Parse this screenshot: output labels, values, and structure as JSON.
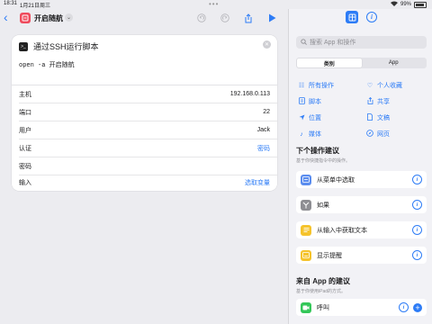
{
  "status": {
    "time": "18:31",
    "date": "1月21日周三",
    "battery": "99%"
  },
  "toolbar": {
    "shortcut_name": "开启随航"
  },
  "action": {
    "title": "通过SSH运行脚本",
    "script": "open -a 开启随航",
    "fields": [
      {
        "label": "主机",
        "value": "192.168.0.113",
        "link": false
      },
      {
        "label": "端口",
        "value": "22",
        "link": false
      },
      {
        "label": "用户",
        "value": "Jack",
        "link": false
      },
      {
        "label": "认证",
        "value": "密码",
        "link": true
      },
      {
        "label": "密码",
        "value": "",
        "link": false
      },
      {
        "label": "输入",
        "value": "选取变量",
        "link": true
      }
    ]
  },
  "sidebar": {
    "search_placeholder": "搜索 App 和操作",
    "segments": [
      "类别",
      "App"
    ],
    "active_segment": 0,
    "categories": [
      {
        "label": "所有操作",
        "icon": "grid-icon"
      },
      {
        "label": "个人收藏",
        "icon": "heart-icon"
      },
      {
        "label": "脚本",
        "icon": "script-icon"
      },
      {
        "label": "共享",
        "icon": "share-icon"
      },
      {
        "label": "位置",
        "icon": "location-icon"
      },
      {
        "label": "文稿",
        "icon": "document-icon"
      },
      {
        "label": "媒体",
        "icon": "music-icon"
      },
      {
        "label": "网页",
        "icon": "compass-icon"
      }
    ],
    "next_title": "下个操作建议",
    "next_sub": "基于你快捷指令中的操作。",
    "suggestions": [
      {
        "label": "从菜单中选取",
        "color": "#5b8def"
      },
      {
        "label": "如果",
        "color": "#8e8e93"
      },
      {
        "label": "从输入中获取文本",
        "color": "#f5c32c"
      },
      {
        "label": "显示提醒",
        "color": "#f5c32c"
      }
    ],
    "app_title": "来自 App 的建议",
    "app_sub": "基于你使用iPad的方式。",
    "app_suggestion": {
      "label": "呼叫",
      "color": "#34c759"
    }
  }
}
